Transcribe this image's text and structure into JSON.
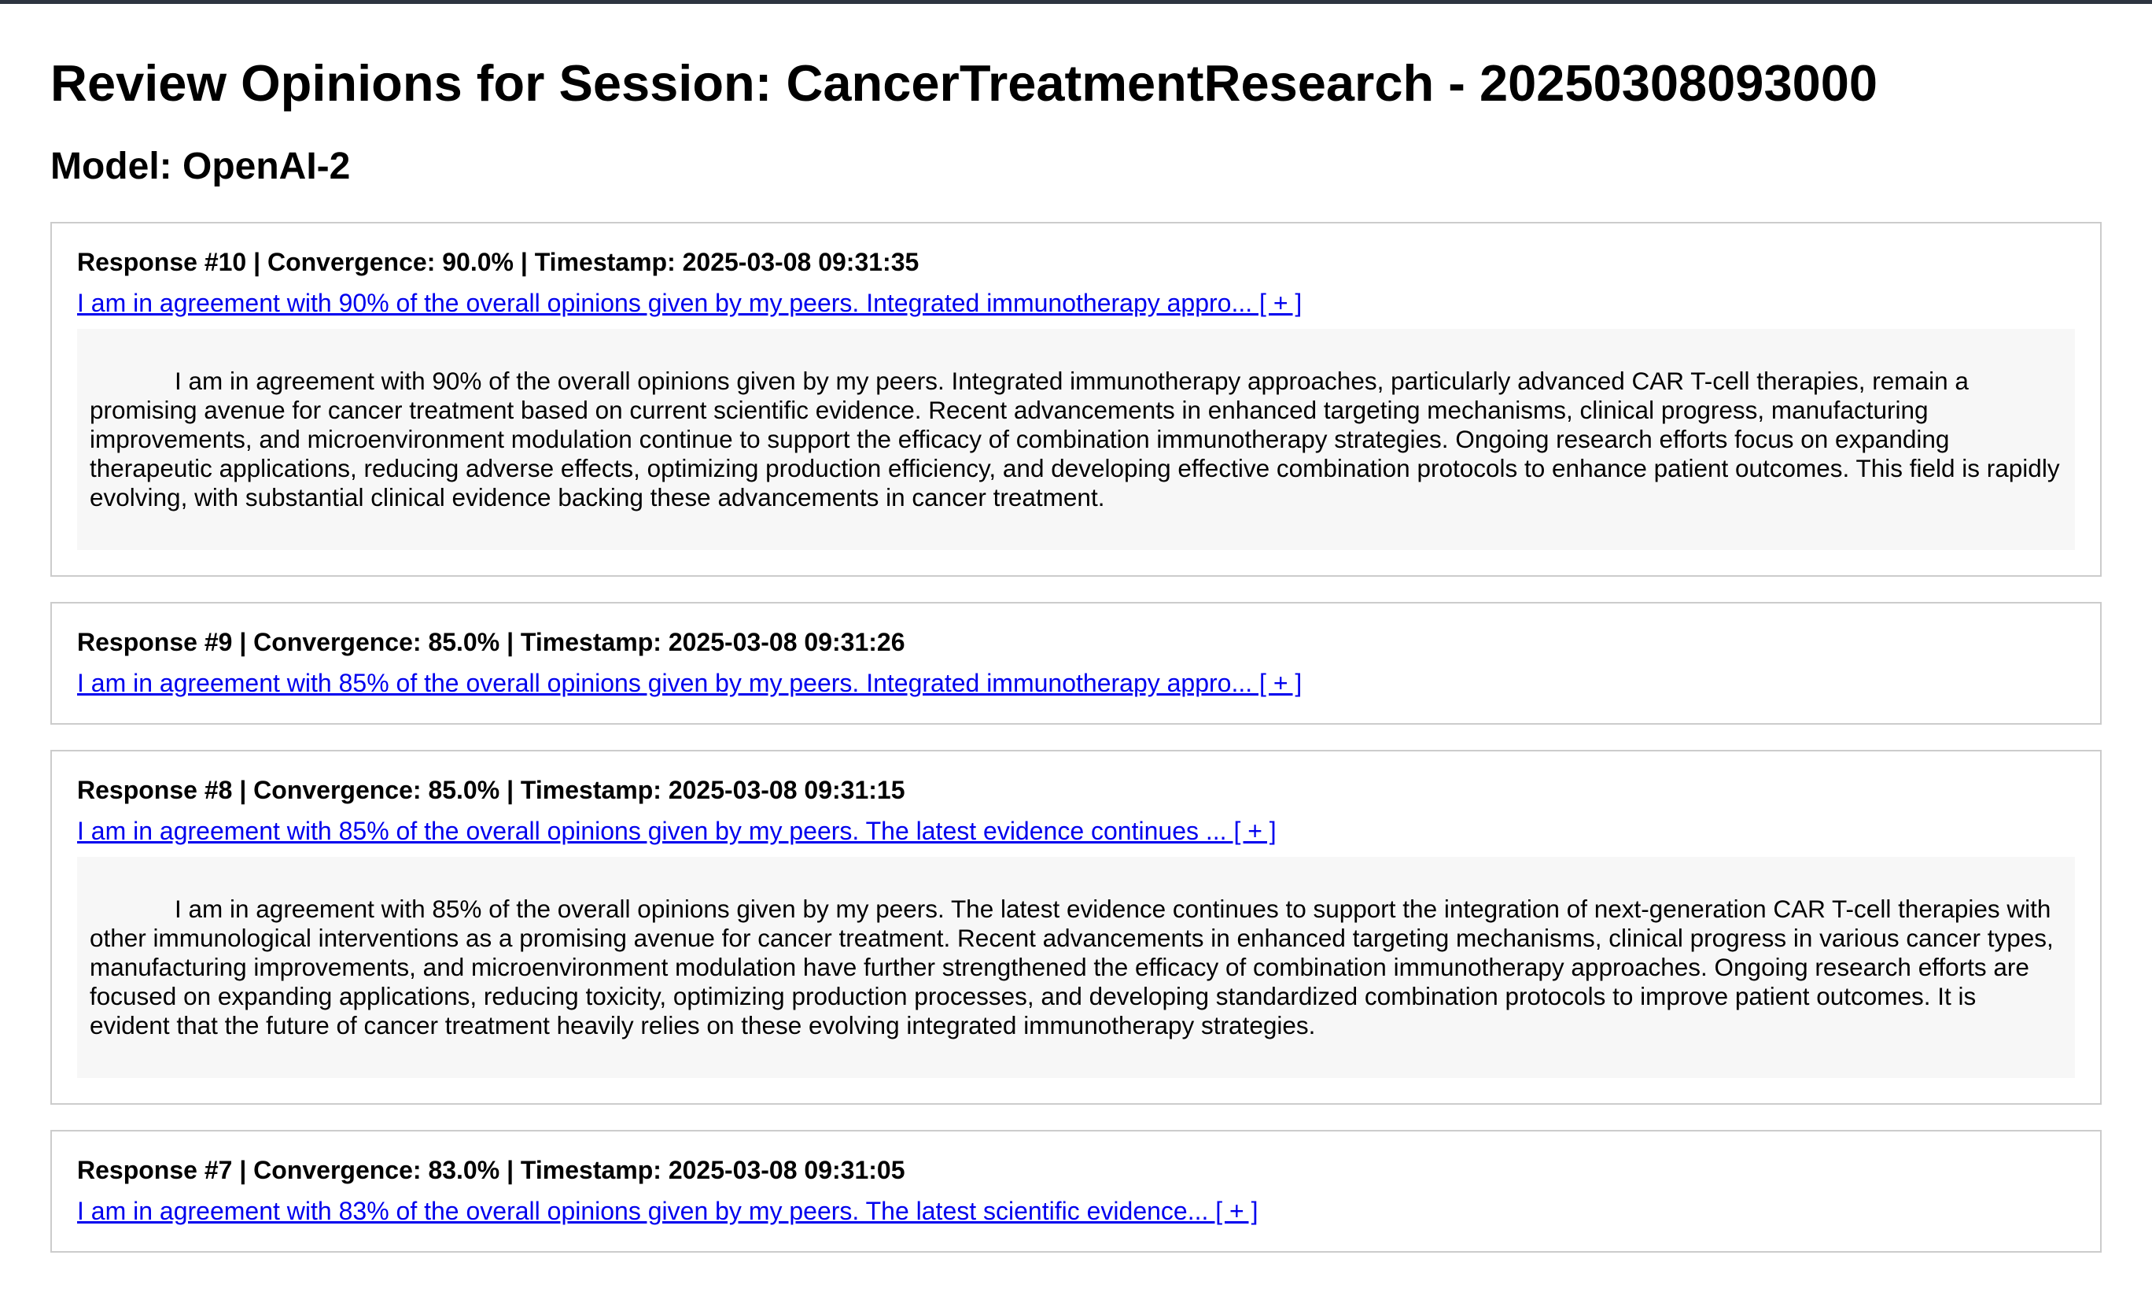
{
  "page": {
    "title": "Review Opinions for Session: CancerTreatmentResearch - 20250308093000",
    "model_heading": "Model: OpenAI-2"
  },
  "responses": [
    {
      "header": "Response #10 | Convergence: 90.0% | Timestamp: 2025-03-08 09:31:35",
      "summary_link": "I am in agreement with 90% of the overall opinions given by my peers. Integrated immunotherapy appro... [ + ]",
      "expanded": true,
      "full_text": "I am in agreement with 90% of the overall opinions given by my peers. Integrated immunotherapy approaches, particularly advanced CAR T-cell therapies, remain a promising avenue for cancer treatment based on current scientific evidence. Recent advancements in enhanced targeting mechanisms, clinical progress, manufacturing improvements, and microenvironment modulation continue to support the efficacy of combination immunotherapy strategies. Ongoing research efforts focus on expanding therapeutic applications, reducing adverse effects, optimizing production efficiency, and developing effective combination protocols to enhance patient outcomes. This field is rapidly evolving, with substantial clinical evidence backing these advancements in cancer treatment."
    },
    {
      "header": "Response #9 | Convergence: 85.0% | Timestamp: 2025-03-08 09:31:26",
      "summary_link": "I am in agreement with 85% of the overall opinions given by my peers. Integrated immunotherapy appro... [ + ]",
      "expanded": false,
      "full_text": ""
    },
    {
      "header": "Response #8 | Convergence: 85.0% | Timestamp: 2025-03-08 09:31:15",
      "summary_link": "I am in agreement with 85% of the overall opinions given by my peers. The latest evidence continues ... [ + ]",
      "expanded": true,
      "full_text": "I am in agreement with 85% of the overall opinions given by my peers. The latest evidence continues to support the integration of next-generation CAR T-cell therapies with other immunological interventions as a promising avenue for cancer treatment. Recent advancements in enhanced targeting mechanisms, clinical progress in various cancer types, manufacturing improvements, and microenvironment modulation have further strengthened the efficacy of combination immunotherapy approaches. Ongoing research efforts are focused on expanding applications, reducing toxicity, optimizing production processes, and developing standardized combination protocols to improve patient outcomes. It is evident that the future of cancer treatment heavily relies on these evolving integrated immunotherapy strategies."
    },
    {
      "header": "Response #7 | Convergence: 83.0% | Timestamp: 2025-03-08 09:31:05",
      "summary_link": "I am in agreement with 83% of the overall opinions given by my peers. The latest scientific evidence... [ + ]",
      "expanded": false,
      "full_text": ""
    }
  ]
}
